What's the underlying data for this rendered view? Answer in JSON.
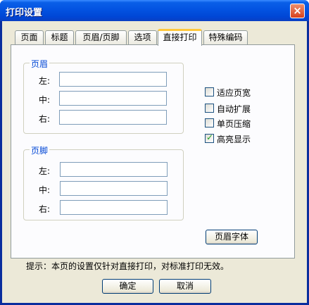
{
  "window": {
    "title": "打印设置",
    "close_symbol": "×"
  },
  "tabs": [
    {
      "label": "页面",
      "active": false
    },
    {
      "label": "标题",
      "active": false
    },
    {
      "label": "页眉/页脚",
      "active": false
    },
    {
      "label": "选项",
      "active": false
    },
    {
      "label": "直接打印",
      "active": true
    },
    {
      "label": "特殊编码",
      "active": false
    }
  ],
  "header_group": {
    "title": "页眉",
    "fields": [
      {
        "label": "左:",
        "value": ""
      },
      {
        "label": "中:",
        "value": ""
      },
      {
        "label": "右:",
        "value": ""
      }
    ]
  },
  "footer_group": {
    "title": "页脚",
    "fields": [
      {
        "label": "左:",
        "value": ""
      },
      {
        "label": "中:",
        "value": ""
      },
      {
        "label": "右:",
        "value": ""
      }
    ]
  },
  "options": [
    {
      "label": "适应页宽",
      "checked": false
    },
    {
      "label": "自动扩展",
      "checked": false
    },
    {
      "label": "单页压缩",
      "checked": false
    },
    {
      "label": "高亮显示",
      "checked": true
    }
  ],
  "checkmark_symbol": "✓",
  "header_font_button": "页眉字体",
  "hint": "提示：本页的设置仅针对直接打印，对标准打印无效。",
  "buttons": {
    "ok": "确定",
    "cancel": "取消"
  },
  "colors": {
    "titlebar": "#0353e1",
    "dialog_bg": "#ece9d8",
    "panel_bg": "#fcfcfe",
    "group_title": "#0046d5",
    "active_tab_accent": "#ffc83c",
    "check_green": "#21a121"
  }
}
